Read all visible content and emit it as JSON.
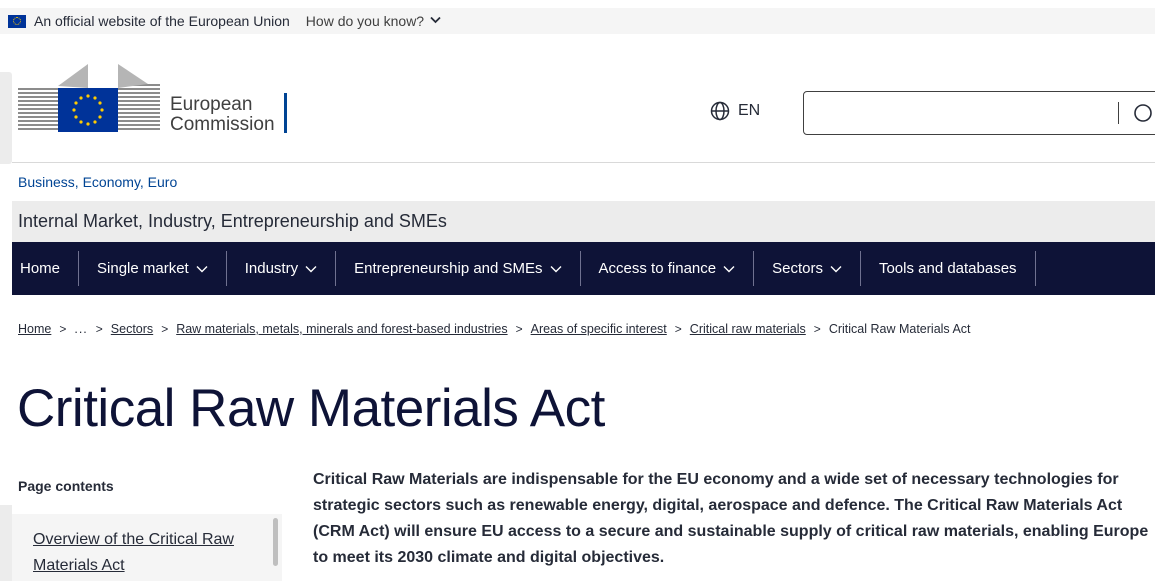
{
  "topbar": {
    "official_text": "An official website of the European Union",
    "how_do_you_know": "How do you know?"
  },
  "header": {
    "logo_line1": "European",
    "logo_line2": "Commission",
    "language": "EN",
    "search_placeholder": ""
  },
  "site": {
    "parent_link": "Business, Economy, Euro",
    "banner_title": "Internal Market, Industry, Entrepreneurship and SMEs"
  },
  "nav": {
    "items": [
      {
        "label": "Home",
        "has_dropdown": false
      },
      {
        "label": "Single market",
        "has_dropdown": true
      },
      {
        "label": "Industry",
        "has_dropdown": true
      },
      {
        "label": "Entrepreneurship and SMEs",
        "has_dropdown": true
      },
      {
        "label": "Access to finance",
        "has_dropdown": true
      },
      {
        "label": "Sectors",
        "has_dropdown": true
      },
      {
        "label": "Tools and databases",
        "has_dropdown": false
      }
    ]
  },
  "breadcrumb": {
    "items": [
      "Home",
      "...",
      "Sectors",
      "Raw materials, metals, minerals and forest-based industries",
      "Areas of specific interest",
      "Critical raw materials"
    ],
    "current": "Critical Raw Materials Act"
  },
  "page": {
    "title": "Critical Raw Materials Act",
    "intro": "Critical Raw Materials are indispensable for the EU economy and a wide set of necessary technologies for strategic sectors such as renewable energy, digital, aerospace and defence. The Critical Raw Materials Act (CRM Act) will ensure EU access to a secure and sustainable supply of critical raw materials, enabling Europe to meet its 2030 climate and digital objectives."
  },
  "toc": {
    "title": "Page contents",
    "items": [
      "Overview of the Critical Raw Materials Act"
    ]
  },
  "colors": {
    "nav_bg": "#0e1337",
    "link": "#004494",
    "eu_blue": "#003399",
    "eu_yellow": "#ffcc00"
  }
}
